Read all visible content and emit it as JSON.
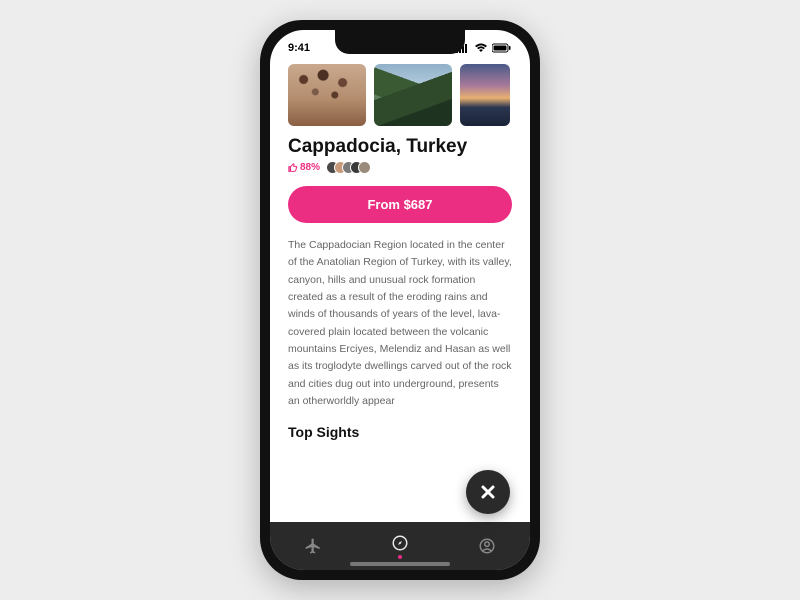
{
  "status": {
    "time": "9:41"
  },
  "destination": {
    "title": "Cappadocia, Turkey",
    "like_pct": "88%",
    "cta": "From $687",
    "description": "The Cappadocian Region located in the center of the Anatolian Region of Turkey, with its valley, canyon, hills and unusual rock formation created as a result of the eroding rains and winds of thousands of years of the level, lava-covered plain located between the volcanic mountains Erciyes, Melendiz and Hasan as well as its troglodyte dwellings carved out of the rock and cities dug out into underground, presents an otherworldly appear",
    "sights_heading": "Top Sights"
  },
  "avatars": [
    {
      "bg": "#4a4a4a"
    },
    {
      "bg": "#c79a7a"
    },
    {
      "bg": "#7a7a7a"
    },
    {
      "bg": "#3a3a3a"
    },
    {
      "bg": "#9a8a7a"
    }
  ],
  "colors": {
    "accent": "#ec2e82",
    "fab": "#2a2a2a",
    "tabbar": "#2a2a2a"
  }
}
